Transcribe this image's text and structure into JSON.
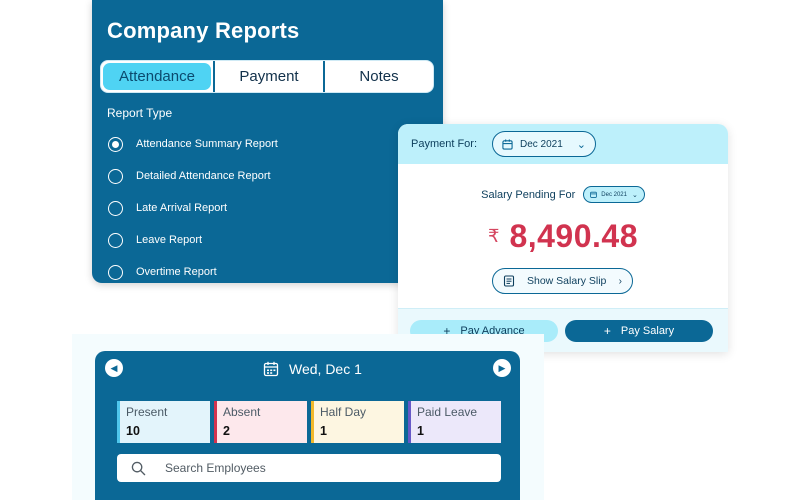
{
  "reports": {
    "title": "Company Reports",
    "tabs": [
      {
        "label": "Attendance",
        "active": true
      },
      {
        "label": "Payment",
        "active": false
      },
      {
        "label": "Notes",
        "active": false
      }
    ],
    "report_type_label": "Report Type",
    "options": [
      {
        "label": "Attendance Summary Report",
        "selected": true
      },
      {
        "label": "Detailed Attendance Report",
        "selected": false
      },
      {
        "label": "Late Arrival Report",
        "selected": false
      },
      {
        "label": "Leave Report",
        "selected": false
      },
      {
        "label": "Overtime Report",
        "selected": false
      }
    ]
  },
  "payment": {
    "payment_for_label": "Payment For:",
    "month": "Dec 2021",
    "salary_pending_label": "Salary Pending For",
    "pending_month": "Dec 2021",
    "amount": "8,490.48",
    "show_slip_label": "Show Salary Slip",
    "pay_advance_label": "Pay Advance",
    "pay_salary_label": "Pay Salary"
  },
  "attendance": {
    "date": "Wed, Dec 1",
    "stats": [
      {
        "label": "Present",
        "value": "10",
        "bg": "#e3f4fb",
        "border": "#4fc6ec"
      },
      {
        "label": "Absent",
        "value": "2",
        "bg": "#fde8ec",
        "border": "#d1334f"
      },
      {
        "label": "Half Day",
        "value": "1",
        "bg": "#fdf6e1",
        "border": "#f1b92b"
      },
      {
        "label": "Paid Leave",
        "value": "1",
        "bg": "#ece8fa",
        "border": "#6658c8"
      }
    ],
    "search_placeholder": "Search Employees"
  },
  "colors": {
    "primary": "#0b6896",
    "accent": "#4fd3f3",
    "amount": "#d1334f"
  }
}
